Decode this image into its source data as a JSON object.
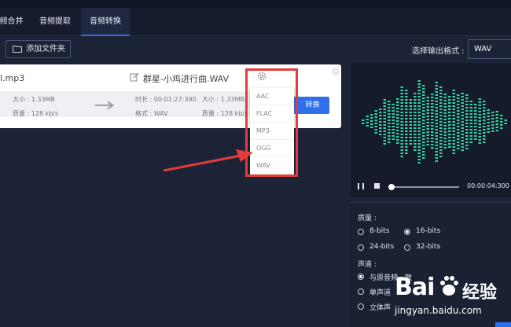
{
  "tabs": [
    {
      "label": "频合并"
    },
    {
      "label": "音频提取"
    },
    {
      "label": "音频转换"
    }
  ],
  "toolbar": {
    "add_folder_label": "添加文件夹",
    "output_format_label": "选择输出格式 :",
    "output_format_value": "WAV"
  },
  "file_card": {
    "source_name": "l.mp3",
    "dest_name": "群星-小鸡进行曲.WAV",
    "src_size": "大小 : 1.33MB",
    "src_quality": "质量 : 128 kb/s",
    "dst_duration": "时长 : 00:01:27:390",
    "dst_format": "格式 : WAV",
    "dst_size": "大小 : 1.33MB",
    "dst_quality": "质量 : 128 kb/s",
    "convert_label": "转换",
    "close_glyph": "×"
  },
  "format_dropdown": {
    "options": [
      "AAC",
      "FLAC",
      "MP3",
      "OGG",
      "WAV"
    ]
  },
  "player": {
    "time": "00:00:04:300",
    "time_suffix": "/"
  },
  "quality": {
    "label": "质量 :",
    "options": [
      "8-bits",
      "16-bits",
      "24-bits",
      "32-bits"
    ],
    "selected": "16-bits"
  },
  "channel": {
    "label": "声道 :",
    "options": [
      "与原音频一致",
      "单声道",
      "立体声"
    ],
    "selected": "与原音频一致"
  },
  "watermark": {
    "brand": "Bai",
    "brand_suffix": "经验",
    "url": "jingyan.baidu.com"
  },
  "colors": {
    "accent": "#2f6fe9",
    "highlight": "#e23b3b",
    "waveform": "#2ed3a6"
  }
}
